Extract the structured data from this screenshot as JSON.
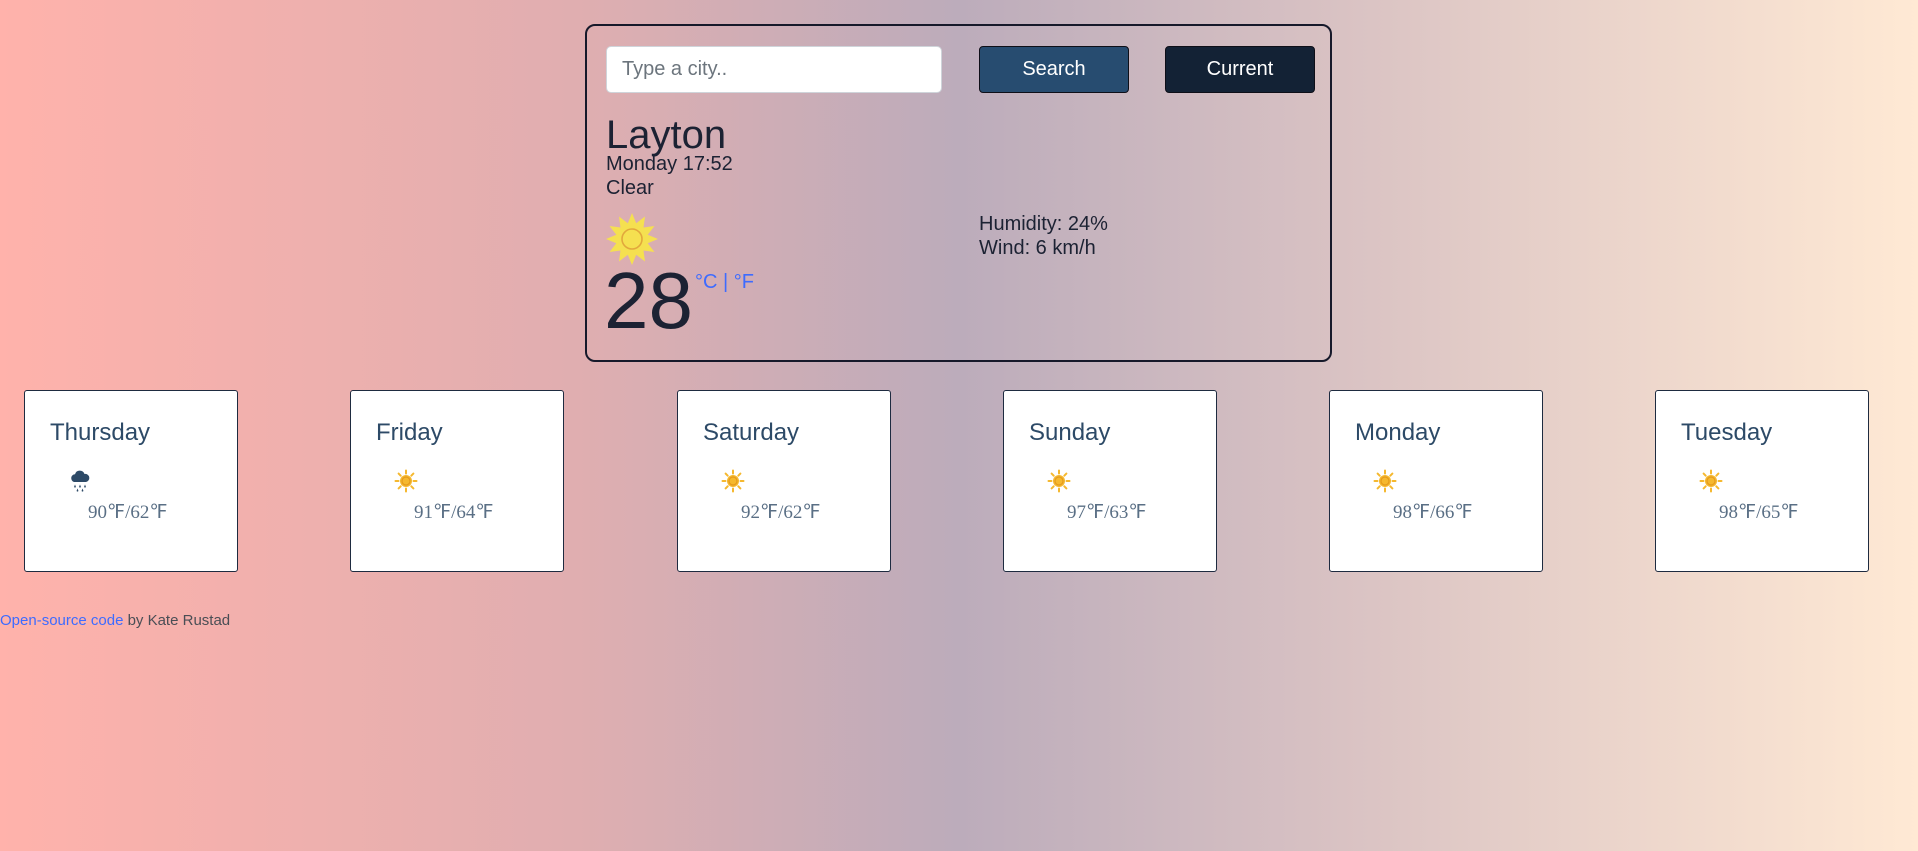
{
  "search": {
    "placeholder": "Type a city..",
    "search_label": "Search",
    "current_label": "Current"
  },
  "current": {
    "city": "Layton",
    "datetime": "Monday 17:52",
    "description": "Clear",
    "icon": "sun-icon",
    "temperature": "28",
    "unit_celsius": "°C",
    "unit_separator": " | ",
    "unit_fahrenheit": "°F",
    "humidity": "Humidity: 24%",
    "wind": "Wind: 6 km/h"
  },
  "forecast": [
    {
      "day": "Thursday",
      "icon": "rain-cloud-icon",
      "temps": "90℉/62℉"
    },
    {
      "day": "Friday",
      "icon": "sun-icon",
      "temps": "91℉/64℉"
    },
    {
      "day": "Saturday",
      "icon": "sun-icon",
      "temps": "92℉/62℉"
    },
    {
      "day": "Sunday",
      "icon": "sun-icon",
      "temps": "97℉/63℉"
    },
    {
      "day": "Monday",
      "icon": "sun-icon",
      "temps": "98℉/66℉"
    },
    {
      "day": "Tuesday",
      "icon": "sun-icon",
      "temps": "98℉/65℉"
    }
  ],
  "footer": {
    "link_text": "Open-source code",
    "author_text": " by Kate Rustad"
  },
  "colors": {
    "search_button": "#274c70",
    "current_button": "#132235",
    "unit_link": "#3d6bff",
    "sun": "#f5e050",
    "small_sun": "#f5b82e",
    "rain_cloud": "#2d4a67"
  }
}
